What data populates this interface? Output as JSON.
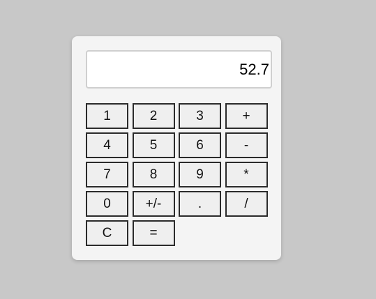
{
  "display": {
    "value": "52.7"
  },
  "keys": [
    {
      "label": "1",
      "name": "key-1"
    },
    {
      "label": "2",
      "name": "key-2"
    },
    {
      "label": "3",
      "name": "key-3"
    },
    {
      "label": "+",
      "name": "key-add"
    },
    {
      "label": "4",
      "name": "key-4"
    },
    {
      "label": "5",
      "name": "key-5"
    },
    {
      "label": "6",
      "name": "key-6"
    },
    {
      "label": "-",
      "name": "key-subtract"
    },
    {
      "label": "7",
      "name": "key-7"
    },
    {
      "label": "8",
      "name": "key-8"
    },
    {
      "label": "9",
      "name": "key-9"
    },
    {
      "label": "*",
      "name": "key-multiply"
    },
    {
      "label": "0",
      "name": "key-0"
    },
    {
      "label": "+/-",
      "name": "key-toggle-sign"
    },
    {
      "label": ".",
      "name": "key-decimal"
    },
    {
      "label": "/",
      "name": "key-divide"
    },
    {
      "label": "C",
      "name": "key-clear"
    },
    {
      "label": "=",
      "name": "key-equals"
    }
  ],
  "colors": {
    "page_background": "#c8c8c8",
    "panel_background": "#f4f4f4",
    "display_background": "#ffffff",
    "key_background": "#efefef",
    "key_border": "#2b2b2b"
  }
}
